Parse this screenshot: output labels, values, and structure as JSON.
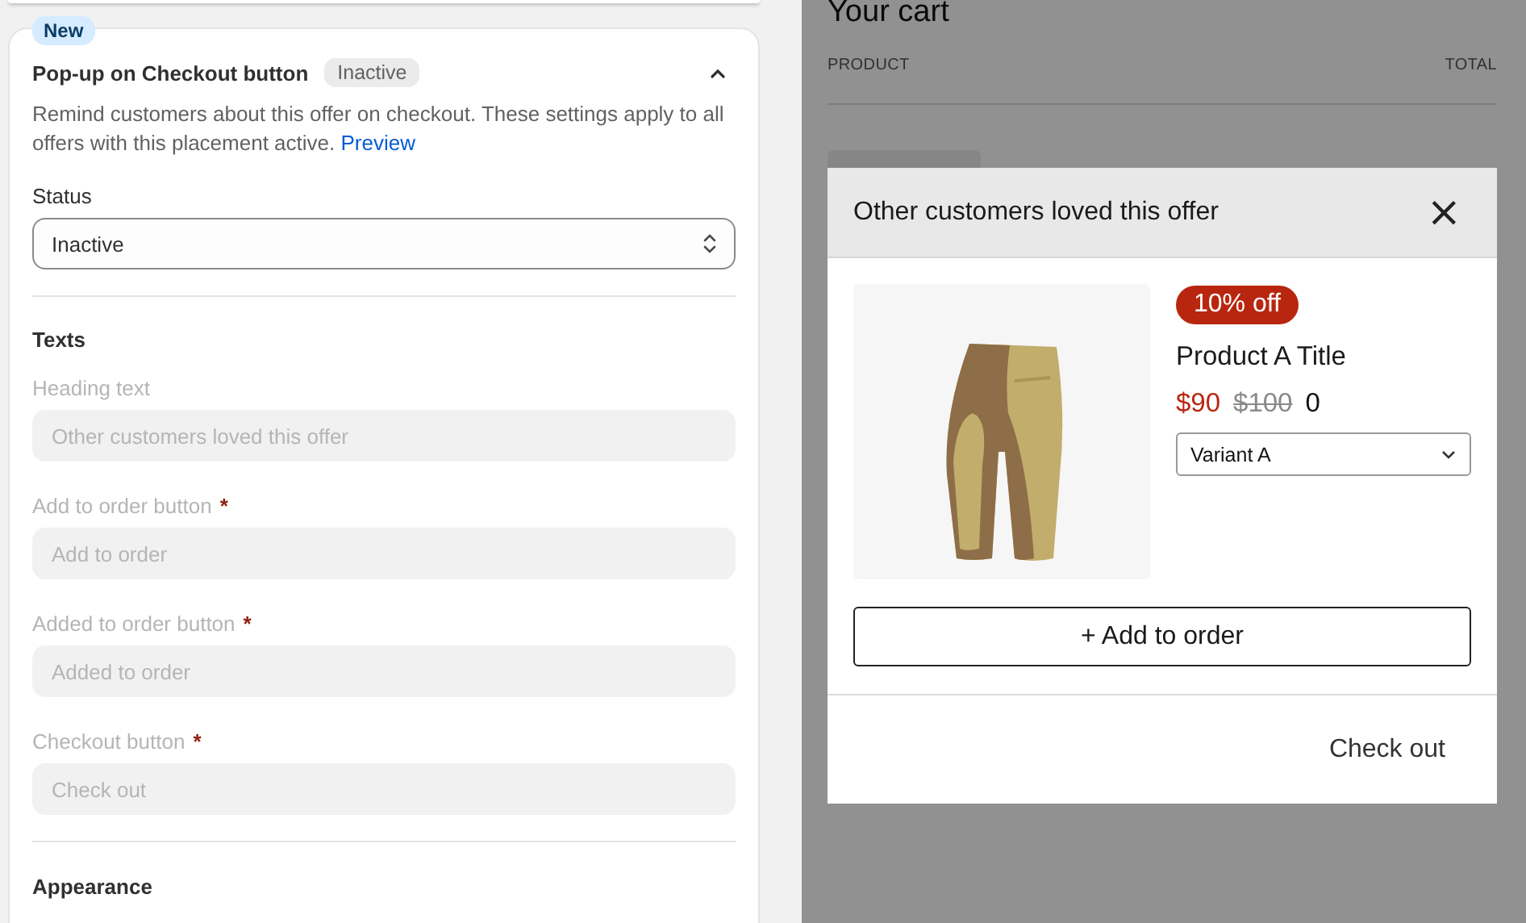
{
  "settings": {
    "badge": "New",
    "title": "Pop-up on Checkout button",
    "status_badge": "Inactive",
    "expanded": true,
    "description": "Remind customers about this offer on checkout. These settings apply to all offers with this placement active.",
    "link": "Preview",
    "status": {
      "label": "Status",
      "value": "Inactive"
    },
    "texts_heading": "Texts",
    "fields": [
      {
        "label": "Heading text",
        "placeholder": "Other customers loved this offer",
        "required": false,
        "disabled": true
      },
      {
        "label": "Add to order button",
        "placeholder": "Add to order",
        "required": true,
        "disabled": true
      },
      {
        "label": "Added to order button",
        "placeholder": "Added to order",
        "required": true,
        "disabled": true
      },
      {
        "label": "Checkout button",
        "placeholder": "Check out",
        "required": true,
        "disabled": true
      }
    ],
    "required_mark": "*",
    "appearance_heading": "Appearance"
  },
  "cart": {
    "title": "Your cart",
    "columns": [
      "PRODUCT",
      "TOTAL"
    ]
  },
  "popup": {
    "title": "Other customers loved this offer",
    "close": "×",
    "discount": "10% off",
    "product": "Product A Title",
    "sale_price": "$90",
    "original_price": "$100",
    "extra": "0",
    "variant": "Variant A",
    "add_button": "+ Add to order",
    "checkout": "Check out"
  }
}
